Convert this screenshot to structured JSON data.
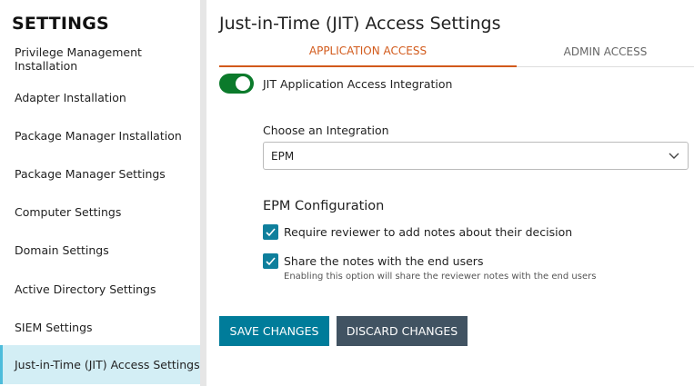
{
  "sidebar": {
    "title": "SETTINGS",
    "items": [
      {
        "label": "Privilege Management Installation"
      },
      {
        "label": "Adapter Installation"
      },
      {
        "label": "Package Manager Installation"
      },
      {
        "label": "Package Manager Settings"
      },
      {
        "label": "Computer Settings"
      },
      {
        "label": "Domain Settings"
      },
      {
        "label": "Active Directory Settings"
      },
      {
        "label": "SIEM Settings"
      },
      {
        "label": "Just-in-Time (JIT) Access Settings",
        "active": true
      }
    ]
  },
  "main": {
    "title": "Just-in-Time (JIT) Access Settings",
    "tabs": [
      {
        "label": "APPLICATION ACCESS",
        "active": true
      },
      {
        "label": "ADMIN ACCESS"
      }
    ],
    "toggle": {
      "label": "JIT Application Access Integration",
      "on": true
    },
    "integration": {
      "label": "Choose an Integration",
      "value": "EPM"
    },
    "config": {
      "title": "EPM Configuration",
      "options": [
        {
          "label": "Require reviewer to add notes about their decision",
          "checked": true
        },
        {
          "label": "Share the notes with the end users",
          "checked": true,
          "hint": "Enabling this option will share the reviewer notes with the end users"
        }
      ]
    },
    "save_label": "SAVE CHANGES",
    "discard_label": "DISCARD CHANGES"
  },
  "colors": {
    "accent": "#d25a1b",
    "primary": "#007c9a",
    "toggle": "#0b7a2b",
    "secondary": "#415362"
  }
}
